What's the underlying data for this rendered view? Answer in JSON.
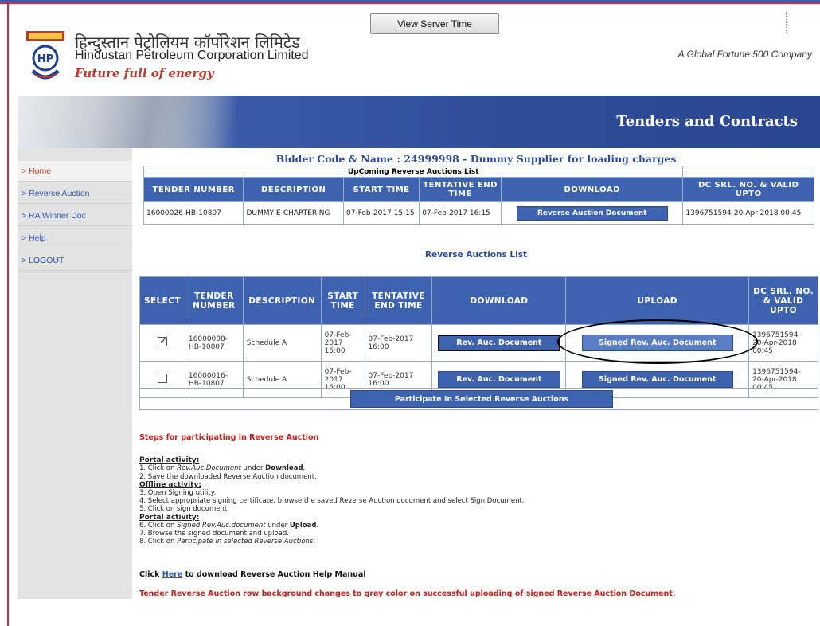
{
  "header": {
    "hindi_name": "हिन्दुस्तान पेट्रोलियम कॉर्पोरेशन लिमिटेड",
    "company_name": "Hindustan Petroleum Corporation Limited",
    "tagline": "Future full of energy",
    "fortune": "A Global Fortune 500 Company",
    "server_button": "View Server Time",
    "logo_text": "HP"
  },
  "banner": {
    "title": "Tenders and Contracts"
  },
  "sidebar": {
    "items": [
      {
        "label": "> Home"
      },
      {
        "label": "> Reverse Auction"
      },
      {
        "label": "> RA Winner Doc"
      },
      {
        "label": "> Help"
      },
      {
        "label": "> LOGOUT"
      }
    ]
  },
  "bidder": "Bidder Code & Name : 24999998 - Dummy Supplier for loading charges",
  "upcoming": {
    "caption": "UpComing Reverse Auctions List",
    "headers": [
      "TENDER NUMBER",
      "DESCRIPTION",
      "START TIME",
      "TENTATIVE END TIME",
      "DOWNLOAD",
      "DC SRL. NO. & VALID UPTO"
    ],
    "rows": [
      {
        "tender": "16000026-HB-10807",
        "desc": "DUMMY E-CHARTERING",
        "start": "07-Feb-2017 15:15",
        "end": "07-Feb-2017 16:15",
        "download": "Reverse Auction Document",
        "dc": "1396751594-20-Apr-2018 00:45"
      }
    ]
  },
  "list_title": "Reverse Auctions List",
  "auctions": {
    "headers": [
      "SELECT",
      "TENDER NUMBER",
      "DESCRIPTION",
      "START TIME",
      "TENTATIVE END TIME",
      "DOWNLOAD",
      "UPLOAD",
      "DC SRL. NO. & VALID UPTO"
    ],
    "rows": [
      {
        "selected": true,
        "tender_a": "16000008-",
        "tender_b": "HB-10807",
        "desc": "Schedule A",
        "start_a": "07-Feb-",
        "start_b": "2017",
        "start_c": "15:00",
        "end_a": "07-Feb-2017",
        "end_b": "16:00",
        "download": "Rev. Auc. Document",
        "upload": "Signed Rev. Auc. Document",
        "dc_a": "1396751594-",
        "dc_b": "20-Apr-2018",
        "dc_c": "00:45"
      },
      {
        "selected": false,
        "tender_a": "16000016-",
        "tender_b": "HB-10807",
        "desc": "Schedule A",
        "start_a": "07-Feb-",
        "start_b": "2017",
        "start_c": "15:00",
        "end_a": "07-Feb-2017",
        "end_b": "16:00",
        "download": "Rev. Auc. Document",
        "upload": "Signed Rev. Auc. Document",
        "dc_a": "1396751594-",
        "dc_b": "20-Apr-2018",
        "dc_c": "00:45"
      }
    ],
    "participate": "Participate In Selected Reverse Auctions"
  },
  "steps": {
    "title": "Steps for participating in Reverse Auction",
    "portal1": "Portal activity:",
    "s1_pre": "1. Click on ",
    "s1_em": "Rev.Auc.Document",
    "s1_mid": " under ",
    "s1_b": "Download",
    "s1_post": ".",
    "s2": "2. Save the downloaded Reverse Auction document.",
    "offline": "Offline activity:",
    "s3": "3. Open Signing utility.",
    "s4": "4. Select appropriate signing certificate, browse the saved Reverse Auction document and select Sign Document.",
    "s5": "5. Click on sign document.",
    "portal2": "Portal activity:",
    "s6_pre": "6. Click on ",
    "s6_em": "Signed Rev.Auc.document",
    "s6_mid": " under ",
    "s6_b": "Upload",
    "s6_post": ".",
    "s7": "7. Browse the signed document and upload.",
    "s8_pre": "8. Click on ",
    "s8_em": "Participate in selected Reverse Auctions",
    "s8_post": "."
  },
  "help": {
    "pre": "Click ",
    "link": "Here",
    "post": " to download Reverse Auction Help Manual"
  },
  "note": "Tender Reverse Auction row background changes to gray color on successful uploading of signed Reverse Auction Document."
}
